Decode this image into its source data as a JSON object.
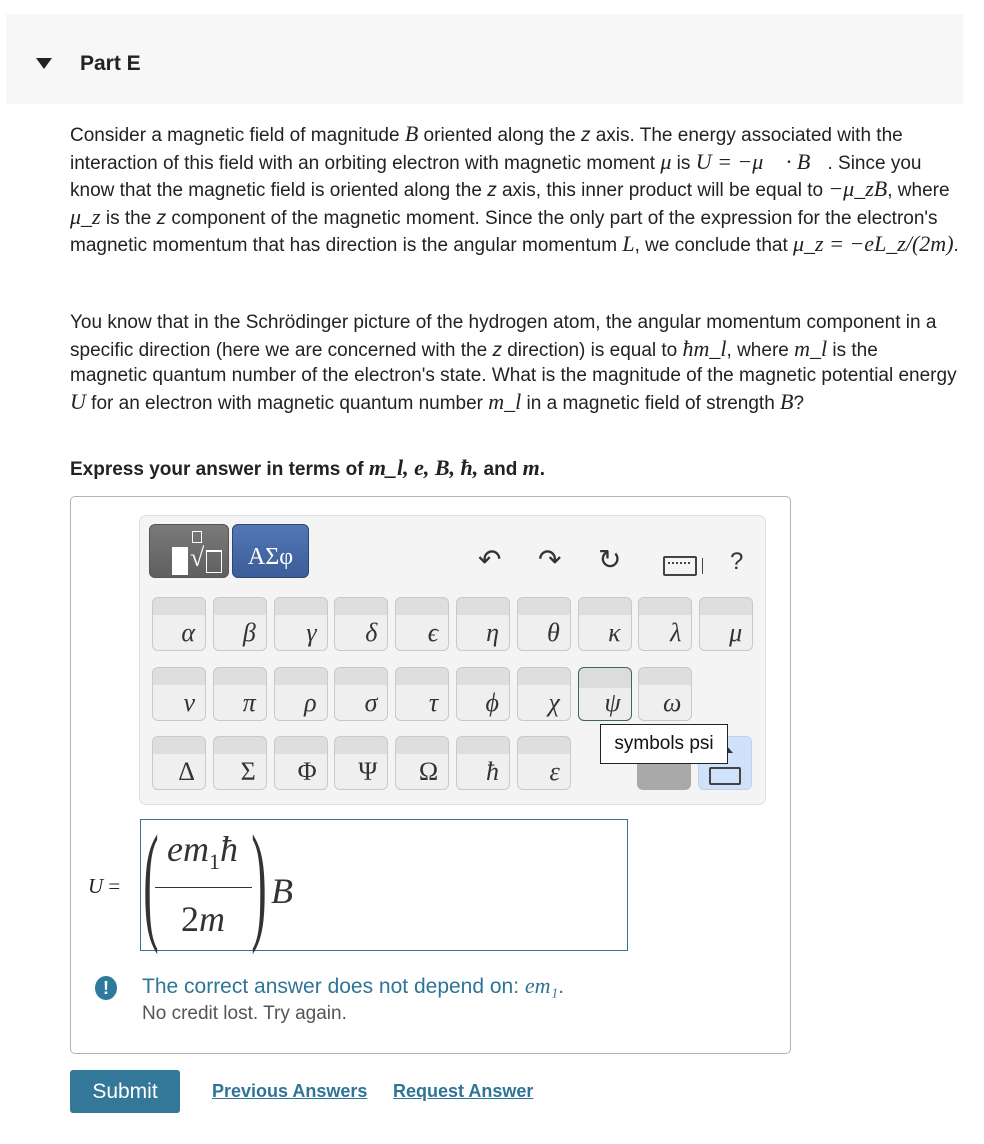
{
  "part": {
    "title": "Part E"
  },
  "problem": {
    "p1_a": "Consider a magnetic field of magnitude ",
    "p1_B": "B",
    "p1_b": " oriented along the ",
    "p1_z": "z",
    "p1_c": " axis. The energy associated with the interaction of this field with an orbiting electron with magnetic moment ",
    "p1_mu": "μ",
    "p1_d": " is ",
    "p1_eq": "U = −μ⃗ · B⃗",
    "p1_e": ". Since you know that the magnetic field is oriented along the ",
    "p1_z2": "z",
    "p1_f": " axis, this inner product will be equal to ",
    "p1_eq2": "−μ_zB",
    "p1_g": ", where ",
    "p1_muz": "μ_z",
    "p1_h": " is the ",
    "p1_z3": "z",
    "p1_i": " component of the magnetic moment. Since the only part of the expression for the electron's magnetic momentum that has direction is the angular momentum ",
    "p1_L": "L",
    "p1_j": ", we conclude that ",
    "p1_eq3": "μ_z = −eL_z/(2m)",
    "p1_k": ".",
    "p2_a": "You know that in the Schrödinger picture of the hydrogen atom, the angular momentum component in a specific direction (here we are concerned with the ",
    "p2_z": "z",
    "p2_b": " direction) is equal to ",
    "p2_eq": "ħm_l",
    "p2_c": ", where ",
    "p2_ml": "m_l",
    "p2_d": " is the magnetic quantum number of the electron's state. What is the magnitude of the magnetic potential energy ",
    "p2_U": "U",
    "p2_e": " for an electron with magnetic quantum number ",
    "p2_ml2": "m_l",
    "p2_f": " in a magnetic field of strength ",
    "p2_B": "B",
    "p2_g": "?",
    "express_a": "Express your answer in terms of ",
    "express_vars": "m_l, e, B, ħ,",
    "express_b": " and ",
    "express_m": "m",
    "express_c": "."
  },
  "toolbar": {
    "templates_label": "templates",
    "symbols_label": "ΑΣφ",
    "undo": "↶",
    "redo": "↷",
    "reset": "↻",
    "help": "?"
  },
  "symbols": {
    "row1": [
      "α",
      "β",
      "γ",
      "δ",
      "ϵ",
      "η",
      "θ",
      "κ",
      "λ",
      "μ"
    ],
    "row2": [
      "ν",
      "π",
      "ρ",
      "σ",
      "τ",
      "ϕ",
      "χ",
      "ψ",
      "ω"
    ],
    "row3": [
      "Δ",
      "Σ",
      "Φ",
      "Ψ",
      "Ω",
      "ħ",
      "ε"
    ]
  },
  "tooltip": "symbols psi",
  "answer": {
    "label_var": "U",
    "label_eq": " =",
    "numerator": "em",
    "numerator_sub": "1",
    "numerator_tail": "ħ",
    "denominator_num": "2",
    "denominator_var": "m",
    "trailing": "B"
  },
  "feedback": {
    "icon": "!",
    "main": "The correct answer does not depend on: ",
    "main_math": "em₁",
    "main_end": ".",
    "sub": "No credit lost. Try again."
  },
  "actions": {
    "submit": "Submit",
    "previous": "Previous Answers",
    "request": "Request Answer"
  }
}
